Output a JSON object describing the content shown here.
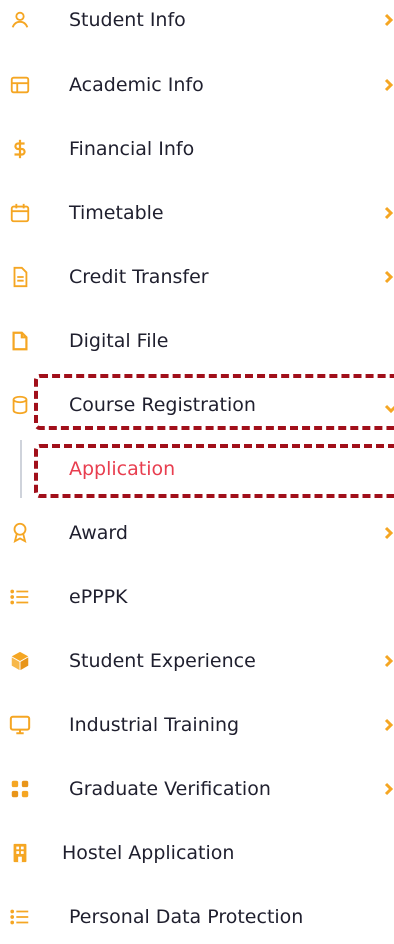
{
  "menu": {
    "items": [
      {
        "label": "Student Info",
        "icon": "user-icon",
        "chevron": "right"
      },
      {
        "label": "Academic Info",
        "icon": "layout-icon",
        "chevron": "right"
      },
      {
        "label": "Financial Info",
        "icon": "dollar-icon",
        "chevron": ""
      },
      {
        "label": "Timetable",
        "icon": "calendar-icon",
        "chevron": "right"
      },
      {
        "label": "Credit Transfer",
        "icon": "document-icon",
        "chevron": "right"
      },
      {
        "label": "Digital File",
        "icon": "file-icon",
        "chevron": ""
      },
      {
        "label": "Course Registration",
        "icon": "database-icon",
        "chevron": "down"
      },
      {
        "label": "Application",
        "icon": "",
        "chevron": ""
      },
      {
        "label": "Award",
        "icon": "award-icon",
        "chevron": "right"
      },
      {
        "label": "ePPPK",
        "icon": "list-icon",
        "chevron": ""
      },
      {
        "label": "Student Experience",
        "icon": "box-icon",
        "chevron": "right"
      },
      {
        "label": "Industrial Training",
        "icon": "monitor-icon",
        "chevron": "right"
      },
      {
        "label": "Graduate Verification",
        "icon": "apps-icon",
        "chevron": "right"
      },
      {
        "label": "Hostel Application",
        "icon": "building-icon",
        "chevron": ""
      },
      {
        "label": "Personal Data Protection",
        "icon": "list-icon",
        "chevron": ""
      }
    ]
  },
  "colors": {
    "icon": "#f5a623",
    "text": "#1f1f2e",
    "active": "#e83e4f",
    "highlight": "#a10f1a",
    "chevron": "#f5a623"
  }
}
